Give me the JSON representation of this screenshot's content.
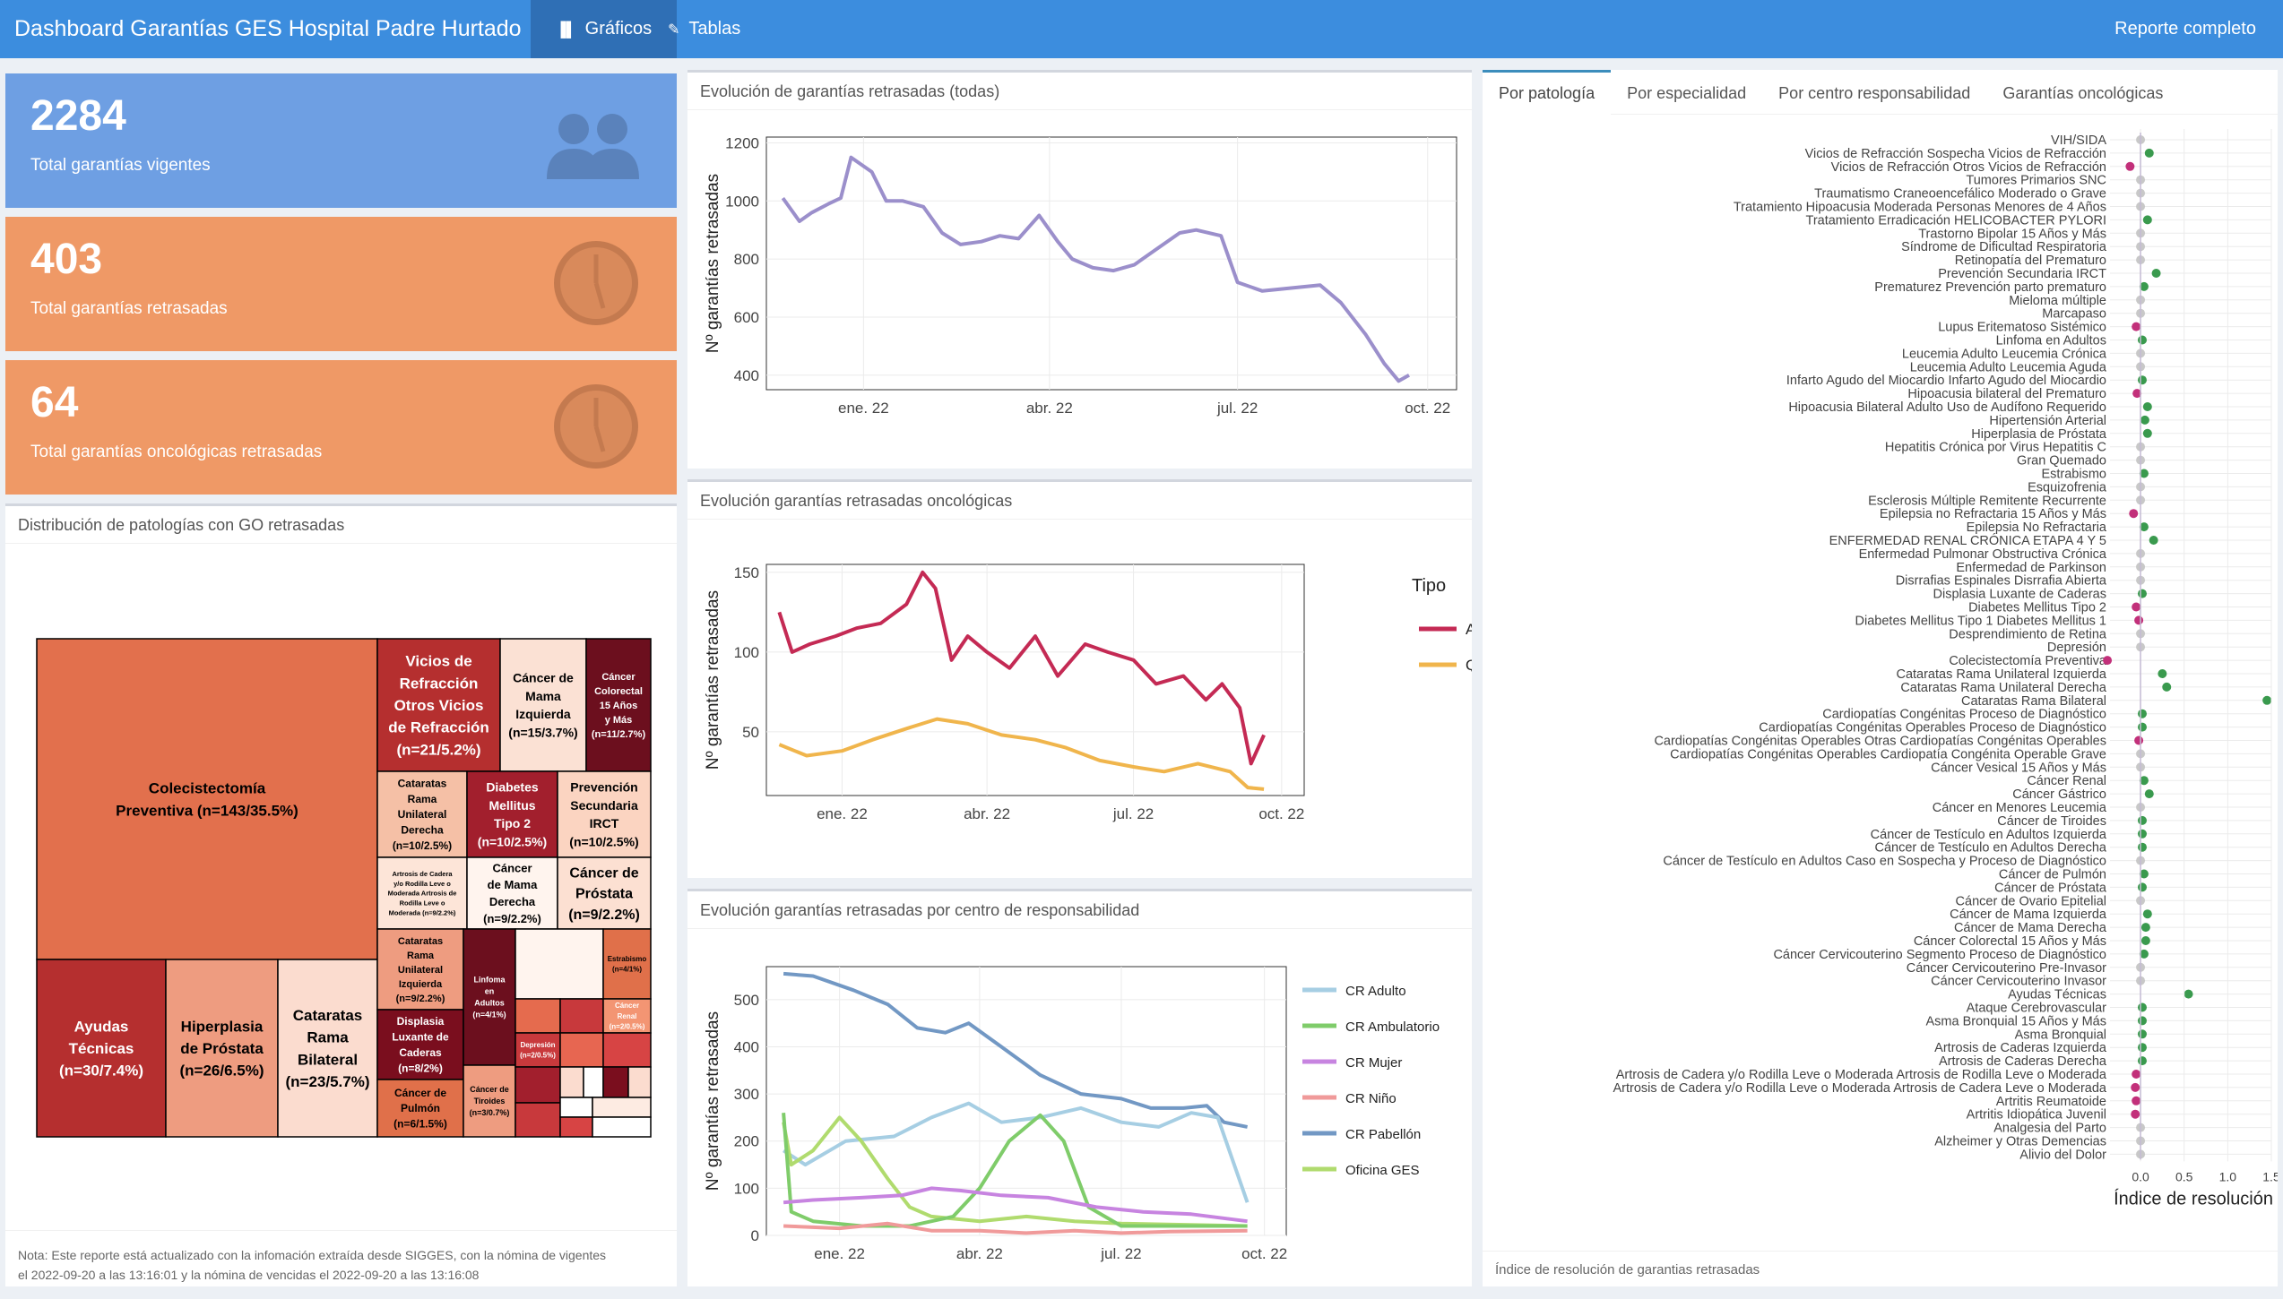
{
  "header": {
    "title": "Dashboard Garantías GES Hospital Padre Hurtado",
    "nav_graficos": "Gráficos",
    "nav_tablas": "Tablas",
    "report": "Reporte completo"
  },
  "value_boxes": [
    {
      "value": "2284",
      "label": "Total garantías vigentes",
      "color": "#6b9ee2",
      "icon": "users-icon"
    },
    {
      "value": "403",
      "label": "Total garantías retrasadas",
      "color": "#ef9966",
      "icon": "clock-icon"
    },
    {
      "value": "64",
      "label": "Total garantías oncológicas retrasadas",
      "color": "#ef9966",
      "icon": "clock-icon"
    }
  ],
  "treemap_panel": {
    "title": "Distribución de patologías con GO retrasadas",
    "note1": "Nota: Este reporte está actualizado con la infomación extraída desde SIGGES, con la nómina de vigentes",
    "note2": "el 2022-09-20 a las 13:16:01 y la nómina de vencidas el 2022-09-20 a las 13:16:08"
  },
  "treemap_labels": {
    "colecistectomia": [
      "Colecistectomía",
      "Preventiva (n=143/35.5%)"
    ],
    "ayudas": [
      "Ayudas",
      "Técnicas",
      "(n=30/7.4%)"
    ],
    "hiperplasia": [
      "Hiperplasia",
      "de Próstata",
      "(n=26/6.5%)"
    ],
    "cataratas_bil": [
      "Cataratas",
      "Rama",
      "Bilateral",
      "(n=23/5.7%)"
    ],
    "vicios": [
      "Vicios de",
      "Refracción",
      "Otros Vicios",
      "de Refracción",
      "(n=21/5.2%)"
    ],
    "mama_izq": [
      "Cáncer de",
      "Mama",
      "Izquierda",
      "(n=15/3.7%)"
    ],
    "colorectal": [
      "Cáncer",
      "Colorectal",
      "15 Años",
      "y Más",
      "(n=11/2.7%)"
    ],
    "cat_der": [
      "Cataratas",
      "Rama",
      "Unilateral",
      "Derecha",
      "(n=10/2.5%)"
    ],
    "diabetes": [
      "Diabetes",
      "Mellitus",
      "Tipo 2",
      "(n=10/2.5%)"
    ],
    "prevencion": [
      "Prevención",
      "Secundaria",
      "IRCT",
      "(n=10/2.5%)"
    ],
    "artrosis": [
      "Artrosis de Cadera",
      "y/o Rodilla Leve o",
      "Moderada Artrosis de",
      "Rodilla Leve o",
      "Moderada (n=9/2.2%)"
    ],
    "mama_der": [
      "Cáncer",
      "de Mama",
      "Derecha",
      "(n=9/2.2%)"
    ],
    "prostata": [
      "Cáncer de",
      "Próstata",
      "(n=9/2.2%)"
    ],
    "cat_izq": [
      "Cataratas",
      "Rama",
      "Unilateral",
      "Izquierda",
      "(n=9/2.2%)"
    ],
    "displasia": [
      "Displasia",
      "Luxante de",
      "Caderas",
      "(n=8/2%)"
    ],
    "pulmon": [
      "Cáncer de",
      "Pulmón",
      "(n=6/1.5%)"
    ],
    "linfoma": [
      "Linfoma",
      "en",
      "Adultos",
      "(n=4/1%)"
    ],
    "estrabismo": [
      "Estrabismo",
      "(n=4/1%)"
    ],
    "renal": [
      "Cáncer",
      "Renal",
      "(n=2/0.5%)"
    ],
    "depresion": [
      "Depresión",
      "(n=2/0.5%)"
    ],
    "tiroides": [
      "Cáncer de",
      "Tiroides",
      "(n=3/0.7%)"
    ]
  },
  "chart1": {
    "title": "Evolución de garantías retrasadas (todas)",
    "ylabel": "Nº garantías retrasadas",
    "yticks": [
      "1200",
      "1000",
      "800",
      "600",
      "400"
    ],
    "xticks": [
      "ene. 22",
      "abr. 22",
      "jul. 22",
      "oct. 22"
    ],
    "color": "#9b8fcb"
  },
  "chart2": {
    "title": "Evolución garantías retrasadas oncológicas",
    "ylabel": "Nº garantías retrasadas",
    "yticks": [
      "150",
      "100",
      "50"
    ],
    "xticks": [
      "ene. 22",
      "abr. 22",
      "jul. 22",
      "oct. 22"
    ],
    "legend_title": "Tipo",
    "legend": [
      {
        "name": "Ambulatorio",
        "color": "#c42a54"
      },
      {
        "name": "Quirúrgico",
        "color": "#f0b54c"
      }
    ]
  },
  "chart3": {
    "title": "Evolución garantías retrasadas por centro de responsabilidad",
    "ylabel": "Nº garantías retrasadas",
    "yticks": [
      "500",
      "400",
      "300",
      "200",
      "100",
      "0"
    ],
    "xticks": [
      "ene. 22",
      "abr. 22",
      "jul. 22",
      "oct. 22"
    ],
    "legend": [
      {
        "name": "CR Adulto",
        "color": "#a6cee3"
      },
      {
        "name": "CR Ambulatorio",
        "color": "#7fcc6a"
      },
      {
        "name": "CR Mujer",
        "color": "#c784e0"
      },
      {
        "name": "CR Niño",
        "color": "#f09a9a"
      },
      {
        "name": "CR Pabellón",
        "color": "#7298c4"
      },
      {
        "name": "Oficina GES",
        "color": "#b0db6e"
      }
    ]
  },
  "right_panel": {
    "tabs": [
      "Por patología",
      "Por especialidad",
      "Por centro responsabilidad",
      "Garantías oncológicas"
    ],
    "xlabel": "Índice de resolución",
    "xticks": [
      "0.0",
      "0.5",
      "1.0",
      "1.5"
    ],
    "footer": "Índice de resolución de garantias retrasadas"
  },
  "chart_data": [
    {
      "type": "line",
      "title": "Evolución de garantías retrasadas (todas)",
      "ylabel": "Nº garantías retrasadas",
      "ylim": [
        350,
        1220
      ],
      "xlim": [
        "2021-11-15",
        "2022-10-15"
      ],
      "x": [
        "2021-11-23",
        "2021-12-01",
        "2021-12-07",
        "2021-12-15",
        "2021-12-21",
        "2021-12-26",
        "2022-01-05",
        "2022-01-12",
        "2022-01-20",
        "2022-01-30",
        "2022-02-08",
        "2022-02-17",
        "2022-02-27",
        "2022-03-08",
        "2022-03-17",
        "2022-03-27",
        "2022-04-05",
        "2022-04-12",
        "2022-04-22",
        "2022-05-02",
        "2022-05-12",
        "2022-05-22",
        "2022-06-03",
        "2022-06-11",
        "2022-06-23",
        "2022-07-01",
        "2022-07-13",
        "2022-08-10",
        "2022-08-20",
        "2022-09-01",
        "2022-09-10",
        "2022-09-17",
        "2022-09-22"
      ],
      "y": [
        1010,
        930,
        960,
        990,
        1010,
        1150,
        1100,
        1000,
        1000,
        980,
        890,
        850,
        860,
        880,
        870,
        950,
        860,
        800,
        770,
        760,
        780,
        830,
        890,
        900,
        880,
        720,
        690,
        710,
        650,
        540,
        440,
        380,
        400
      ]
    },
    {
      "type": "line",
      "title": "Evolución garantías retrasadas oncológicas",
      "ylabel": "Nº garantías retrasadas",
      "ylim": [
        10,
        155
      ],
      "series": [
        {
          "name": "Ambulatorio",
          "x": [
            "2021-11-23",
            "2021-12-01",
            "2021-12-12",
            "2021-12-28",
            "2022-01-10",
            "2022-01-25",
            "2022-02-10",
            "2022-02-20",
            "2022-02-28",
            "2022-03-10",
            "2022-03-20",
            "2022-04-01",
            "2022-04-15",
            "2022-05-01",
            "2022-05-15",
            "2022-06-01",
            "2022-06-15",
            "2022-07-01",
            "2022-07-15",
            "2022-08-01",
            "2022-08-15",
            "2022-08-25",
            "2022-09-05",
            "2022-09-12",
            "2022-09-20"
          ],
          "y": [
            125,
            100,
            105,
            110,
            115,
            118,
            130,
            150,
            140,
            95,
            110,
            100,
            90,
            110,
            85,
            105,
            100,
            95,
            80,
            85,
            70,
            80,
            65,
            30,
            48
          ]
        },
        {
          "name": "Quirúrgico",
          "x": [
            "2021-11-23",
            "2021-12-10",
            "2022-01-01",
            "2022-01-20",
            "2022-02-10",
            "2022-03-01",
            "2022-03-20",
            "2022-04-10",
            "2022-05-01",
            "2022-05-20",
            "2022-06-10",
            "2022-07-01",
            "2022-07-20",
            "2022-08-10",
            "2022-08-30",
            "2022-09-10",
            "2022-09-20"
          ],
          "y": [
            42,
            35,
            38,
            45,
            52,
            58,
            55,
            48,
            45,
            40,
            32,
            28,
            25,
            30,
            25,
            15,
            14
          ]
        }
      ]
    },
    {
      "type": "line",
      "title": "Evolución garantías retrasadas por centro de responsabilidad",
      "ylabel": "Nº garantías retrasadas",
      "ylim": [
        0,
        570
      ],
      "series": [
        {
          "name": "CR Pabellón",
          "x": [
            "2021-11-26",
            "2021-12-15",
            "2022-01-10",
            "2022-02-01",
            "2022-02-20",
            "2022-03-10",
            "2022-03-25",
            "2022-04-15",
            "2022-05-10",
            "2022-06-05",
            "2022-07-01",
            "2022-07-20",
            "2022-08-10",
            "2022-08-25",
            "2022-09-05",
            "2022-09-20"
          ],
          "y": [
            555,
            550,
            520,
            490,
            440,
            430,
            450,
            400,
            340,
            300,
            290,
            270,
            270,
            275,
            240,
            230
          ]
        },
        {
          "name": "CR Adulto",
          "x": [
            "2021-11-26",
            "2021-12-10",
            "2022-01-05",
            "2022-02-05",
            "2022-03-01",
            "2022-03-25",
            "2022-04-15",
            "2022-05-10",
            "2022-06-05",
            "2022-07-01",
            "2022-07-25",
            "2022-08-15",
            "2022-09-01",
            "2022-09-20"
          ],
          "y": [
            180,
            150,
            200,
            210,
            250,
            280,
            240,
            250,
            270,
            240,
            230,
            260,
            250,
            70
          ]
        },
        {
          "name": "Oficina GES",
          "x": [
            "2021-11-26",
            "2021-12-01",
            "2021-12-15",
            "2022-01-01",
            "2022-01-15",
            "2022-02-01",
            "2022-02-15",
            "2022-03-01",
            "2022-04-01",
            "2022-05-01",
            "2022-06-01",
            "2022-07-01",
            "2022-09-20"
          ],
          "y": [
            240,
            150,
            180,
            250,
            200,
            120,
            60,
            40,
            30,
            40,
            30,
            25,
            20
          ]
        },
        {
          "name": "CR Ambulatorio",
          "x": [
            "2021-11-26",
            "2021-12-01",
            "2021-12-15",
            "2022-01-15",
            "2022-02-15",
            "2022-03-15",
            "2022-04-01",
            "2022-04-20",
            "2022-05-10",
            "2022-05-25",
            "2022-06-10",
            "2022-07-01",
            "2022-09-20"
          ],
          "y": [
            260,
            50,
            30,
            20,
            20,
            40,
            100,
            200,
            255,
            200,
            60,
            20,
            20
          ]
        },
        {
          "name": "CR Mujer",
          "x": [
            "2021-11-26",
            "2021-12-15",
            "2022-01-15",
            "2022-02-10",
            "2022-03-01",
            "2022-03-20",
            "2022-04-15",
            "2022-05-15",
            "2022-06-15",
            "2022-07-15",
            "2022-08-15",
            "2022-09-20"
          ],
          "y": [
            70,
            75,
            80,
            85,
            100,
            95,
            85,
            80,
            60,
            50,
            45,
            30
          ]
        },
        {
          "name": "CR Niño",
          "x": [
            "2021-11-26",
            "2022-01-01",
            "2022-02-01",
            "2022-03-01",
            "2022-04-01",
            "2022-05-01",
            "2022-06-01",
            "2022-07-01",
            "2022-08-01",
            "2022-09-20"
          ],
          "y": [
            20,
            15,
            25,
            10,
            10,
            5,
            10,
            5,
            8,
            10
          ]
        }
      ]
    },
    {
      "type": "scatter",
      "xlabel": "Índice de resolución",
      "xlim": [
        -0.35,
        1.5
      ],
      "categories": [
        "VIH/SIDA",
        "Vicios de Refracción Sospecha Vicios de Refracción",
        "Vicios de Refracción Otros Vicios de Refracción",
        "Tumores Primarios SNC",
        "Traumatismo Craneoencefálico Moderado o Grave",
        "Tratamiento Hipoacusia Moderada Personas Menores de 4 Años",
        "Tratamiento Erradicación HELICOBACTER PYLORI",
        "Trastorno Bipolar 15 Años y Más",
        "Síndrome de Dificultad Respiratoria",
        "Retinopatía del Prematuro",
        "Prevención Secundaria IRCT",
        "Prematurez Prevención parto prematuro",
        "Mieloma múltiple",
        "Marcapaso",
        "Lupus Eritematoso Sistémico",
        "Linfoma en Adultos",
        "Leucemia Adulto Leucemia Crónica",
        "Leucemia Adulto Leucemia Aguda",
        "Infarto Agudo del Miocardio Infarto Agudo del Miocardio",
        "Hipoacusia bilateral del Prematuro",
        "Hipoacusia Bilateral Adulto Uso de Audífono Requerido",
        "Hipertensión Arterial",
        "Hiperplasia de Próstata",
        "Hepatitis Crónica por Virus Hepatitis C",
        "Gran Quemado",
        "Estrabismo",
        "Esquizofrenia",
        "Esclerosis Múltiple Remitente Recurrente",
        "Epilepsia no Refractaria 15 Años y Más",
        "Epilepsia No Refractaria",
        "ENFERMEDAD RENAL CRÓNICA ETAPA 4 Y 5",
        "Enfermedad Pulmonar Obstructiva Crónica",
        "Enfermedad de Parkinson",
        "Disrrafias Espinales Disrrafia Abierta",
        "Displasia Luxante de Caderas",
        "Diabetes Mellitus Tipo 2",
        "Diabetes Mellitus Tipo 1 Diabetes Mellitus 1",
        "Desprendimiento de Retina",
        "Depresión",
        "Colecistectomía Preventiva",
        "Cataratas Rama Unilateral Izquierda",
        "Cataratas Rama Unilateral Derecha",
        "Cataratas Rama Bilateral",
        "Cardiopatías Congénitas Proceso de Diagnóstico",
        "Cardiopatías Congénitas Operables Proceso de Diagnóstico",
        "Cardiopatías Congénitas Operables Otras Cardiopatías Congénitas Operables",
        "Cardiopatías Congénitas Operables Cardiopatía Congénita Operable Grave",
        "Cáncer Vesical 15 Años y Más",
        "Cáncer Renal",
        "Cáncer Gástrico",
        "Cáncer en Menores Leucemia",
        "Cáncer de Tiroides",
        "Cáncer de Testículo en Adultos Izquierda",
        "Cáncer de Testículo en Adultos Derecha",
        "Cáncer de Testículo en Adultos Caso en Sospecha y Proceso de Diagnóstico",
        "Cáncer de Pulmón",
        "Cáncer de Próstata",
        "Cáncer de Ovario Epitelial",
        "Cáncer de Mama Izquierda",
        "Cáncer de Mama Derecha",
        "Cáncer Colorectal 15 Años y Más",
        "Cáncer Cervicouterino Segmento Proceso de Diagnóstico",
        "Cáncer Cervicouterino Pre-Invasor",
        "Cáncer Cervicouterino Invasor",
        "Ayudas Técnicas",
        "Ataque Cerebrovascular",
        "Asma Bronquial 15 Años y Más",
        "Asma Bronquial",
        "Artrosis de Caderas Izquierda",
        "Artrosis de Caderas Derecha",
        "Artrosis de Cadera y/o Rodilla Leve o Moderada Artrosis de Rodilla Leve o Moderada",
        "Artrosis de Cadera y/o Rodilla Leve o Moderada Artrosis de Cadera Leve o Moderada",
        "Artritis Reumatoide",
        "Artritis Idiopática Juvenil",
        "Analgesia del Parto",
        "Alzheimer y Otras Demencias",
        "Alivio del Dolor"
      ],
      "values": [
        0,
        0.1,
        -0.12,
        0,
        0,
        0,
        0.08,
        0,
        0,
        0,
        0.18,
        0.04,
        0,
        0,
        -0.05,
        0.02,
        0,
        0,
        0.02,
        -0.04,
        0.08,
        0.05,
        0.08,
        0,
        0,
        0.04,
        0,
        0,
        -0.08,
        0.04,
        0.15,
        0,
        0,
        0,
        0.02,
        -0.05,
        -0.02,
        0,
        0,
        -0.38,
        0.25,
        0.3,
        1.45,
        0.02,
        0.02,
        -0.02,
        0,
        0,
        0.04,
        0.1,
        0,
        0.02,
        0.02,
        0.02,
        0,
        0.04,
        0.02,
        0,
        0.08,
        0.06,
        0.06,
        0.04,
        0,
        0,
        0.55,
        0.02,
        0.02,
        0.02,
        0.02,
        0.02,
        -0.05,
        -0.06,
        -0.05,
        -0.06,
        0,
        0,
        0
      ]
    }
  ]
}
